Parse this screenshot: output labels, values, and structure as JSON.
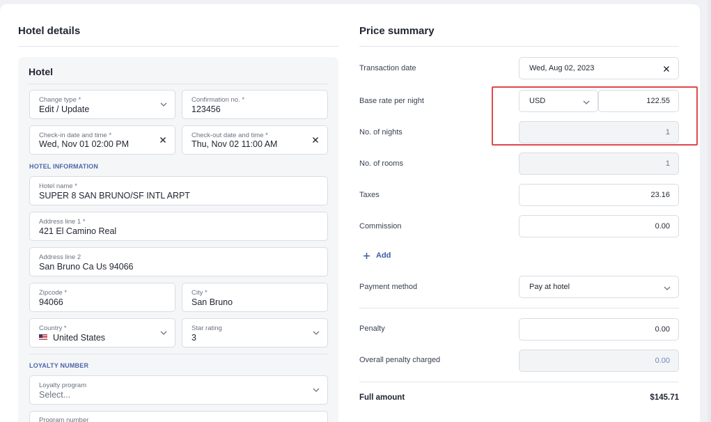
{
  "hotel_details": {
    "title": "Hotel details",
    "box_title": "Hotel",
    "change_type": {
      "label": "Change type *",
      "value": "Edit / Update"
    },
    "confirmation": {
      "label": "Confirmation no. *",
      "value": "123456"
    },
    "checkin": {
      "label": "Check-in date and time *",
      "value": "Wed, Nov 01 02:00 PM"
    },
    "checkout": {
      "label": "Check-out date and time *",
      "value": "Thu, Nov 02 11:00 AM"
    },
    "hotel_info_heading": "HOTEL INFORMATION",
    "hotel_name": {
      "label": "Hotel name *",
      "value": "SUPER 8 SAN BRUNO/SF INTL ARPT"
    },
    "address1": {
      "label": "Address line 1 *",
      "value": "421 El Camino Real"
    },
    "address2": {
      "label": "Address line 2",
      "value": "San Bruno Ca Us 94066"
    },
    "zipcode": {
      "label": "Zipcode *",
      "value": "94066"
    },
    "city": {
      "label": "City *",
      "value": "San Bruno"
    },
    "country": {
      "label": "Country *",
      "value": "United States"
    },
    "star_rating": {
      "label": "Star rating",
      "value": "3"
    },
    "loyalty_heading": "LOYALTY NUMBER",
    "loyalty_program": {
      "label": "Loyalty program",
      "placeholder": "Select..."
    },
    "program_number": {
      "label": "Program number"
    }
  },
  "price_summary": {
    "title": "Price summary",
    "transaction_date": {
      "label": "Transaction date",
      "value": "Wed, Aug 02, 2023"
    },
    "base_rate": {
      "label": "Base rate per night",
      "currency": "USD",
      "value": "122.55"
    },
    "nights": {
      "label": "No. of nights",
      "value": "1"
    },
    "rooms": {
      "label": "No. of rooms",
      "value": "1"
    },
    "taxes": {
      "label": "Taxes",
      "value": "23.16"
    },
    "commission": {
      "label": "Commission",
      "value": "0.00"
    },
    "add_label": "Add",
    "payment_method": {
      "label": "Payment method",
      "value": "Pay at hotel"
    },
    "penalty": {
      "label": "Penalty",
      "value": "0.00"
    },
    "overall_penalty": {
      "label": "Overall penalty charged",
      "value": "0.00"
    },
    "full_amount": {
      "label": "Full amount",
      "value": "$145.71"
    }
  },
  "colors": {
    "accent": "#3c59a8",
    "highlight": "#e0474c",
    "subhead": "#4b66a8"
  }
}
